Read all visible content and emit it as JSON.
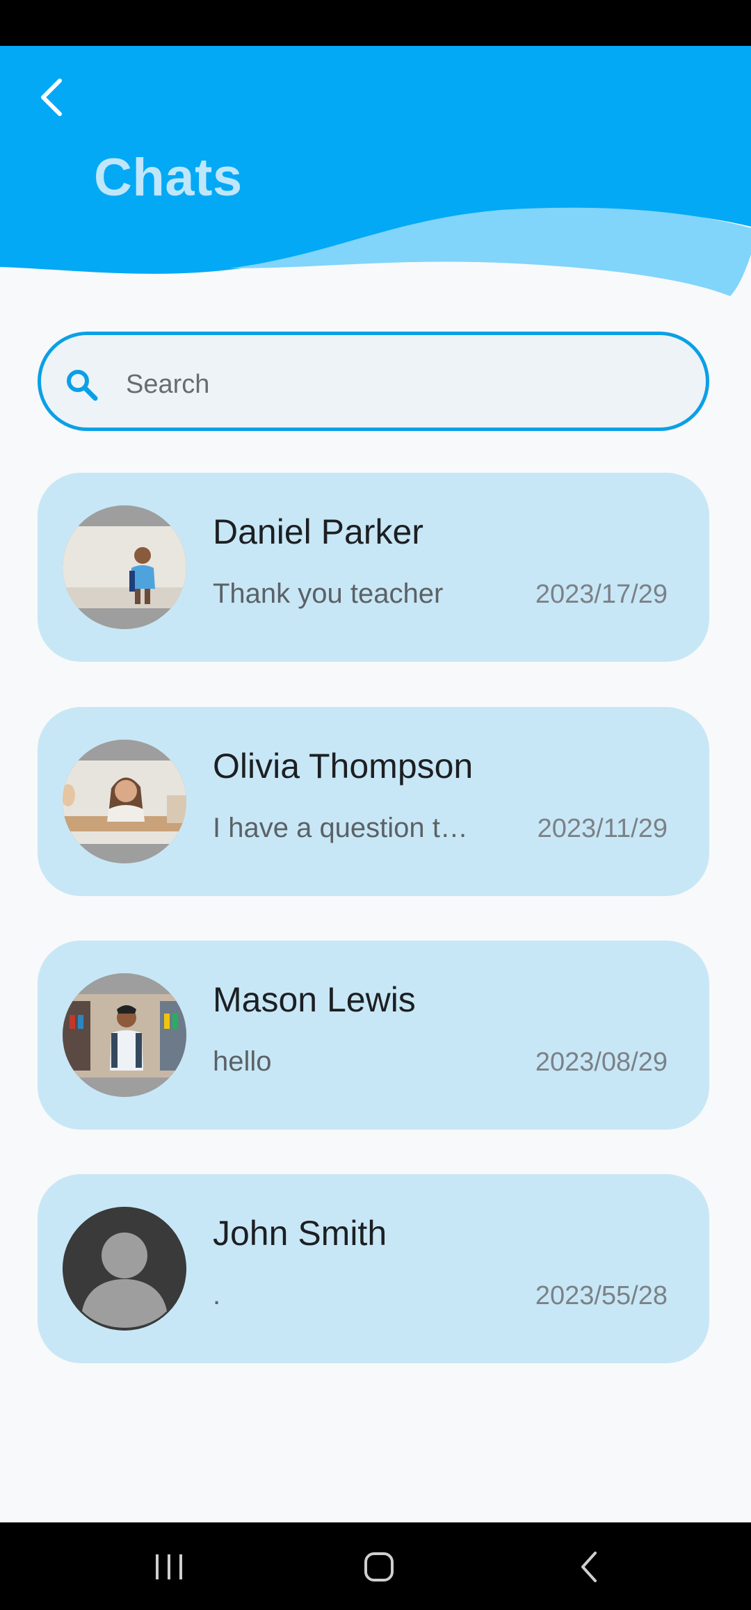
{
  "header": {
    "title": "Chats",
    "back_icon": "chevron-left-icon",
    "colors": {
      "primary": "#03A9F4",
      "wave_light": "#81D4FA",
      "title": "#BFE6FB"
    }
  },
  "search": {
    "placeholder": "Search",
    "value": "",
    "icon": "search-icon",
    "border_color": "#0AA0E6"
  },
  "chats": [
    {
      "name": "Daniel Parker",
      "preview": "Thank you teacher",
      "date": "2023/17/29",
      "avatar": "photo"
    },
    {
      "name": "Olivia Thompson",
      "preview": "I have a question t…",
      "date": "2023/11/29",
      "avatar": "photo"
    },
    {
      "name": "Mason Lewis",
      "preview": "hello",
      "date": "2023/08/29",
      "avatar": "photo"
    },
    {
      "name": "John Smith",
      "preview": ".",
      "date": "2023/55/28",
      "avatar": "default-user-icon"
    }
  ],
  "card_color": "#C8E7F6",
  "nav": {
    "recents_icon": "recents-icon",
    "home_icon": "home-icon",
    "back_icon": "back-icon"
  }
}
